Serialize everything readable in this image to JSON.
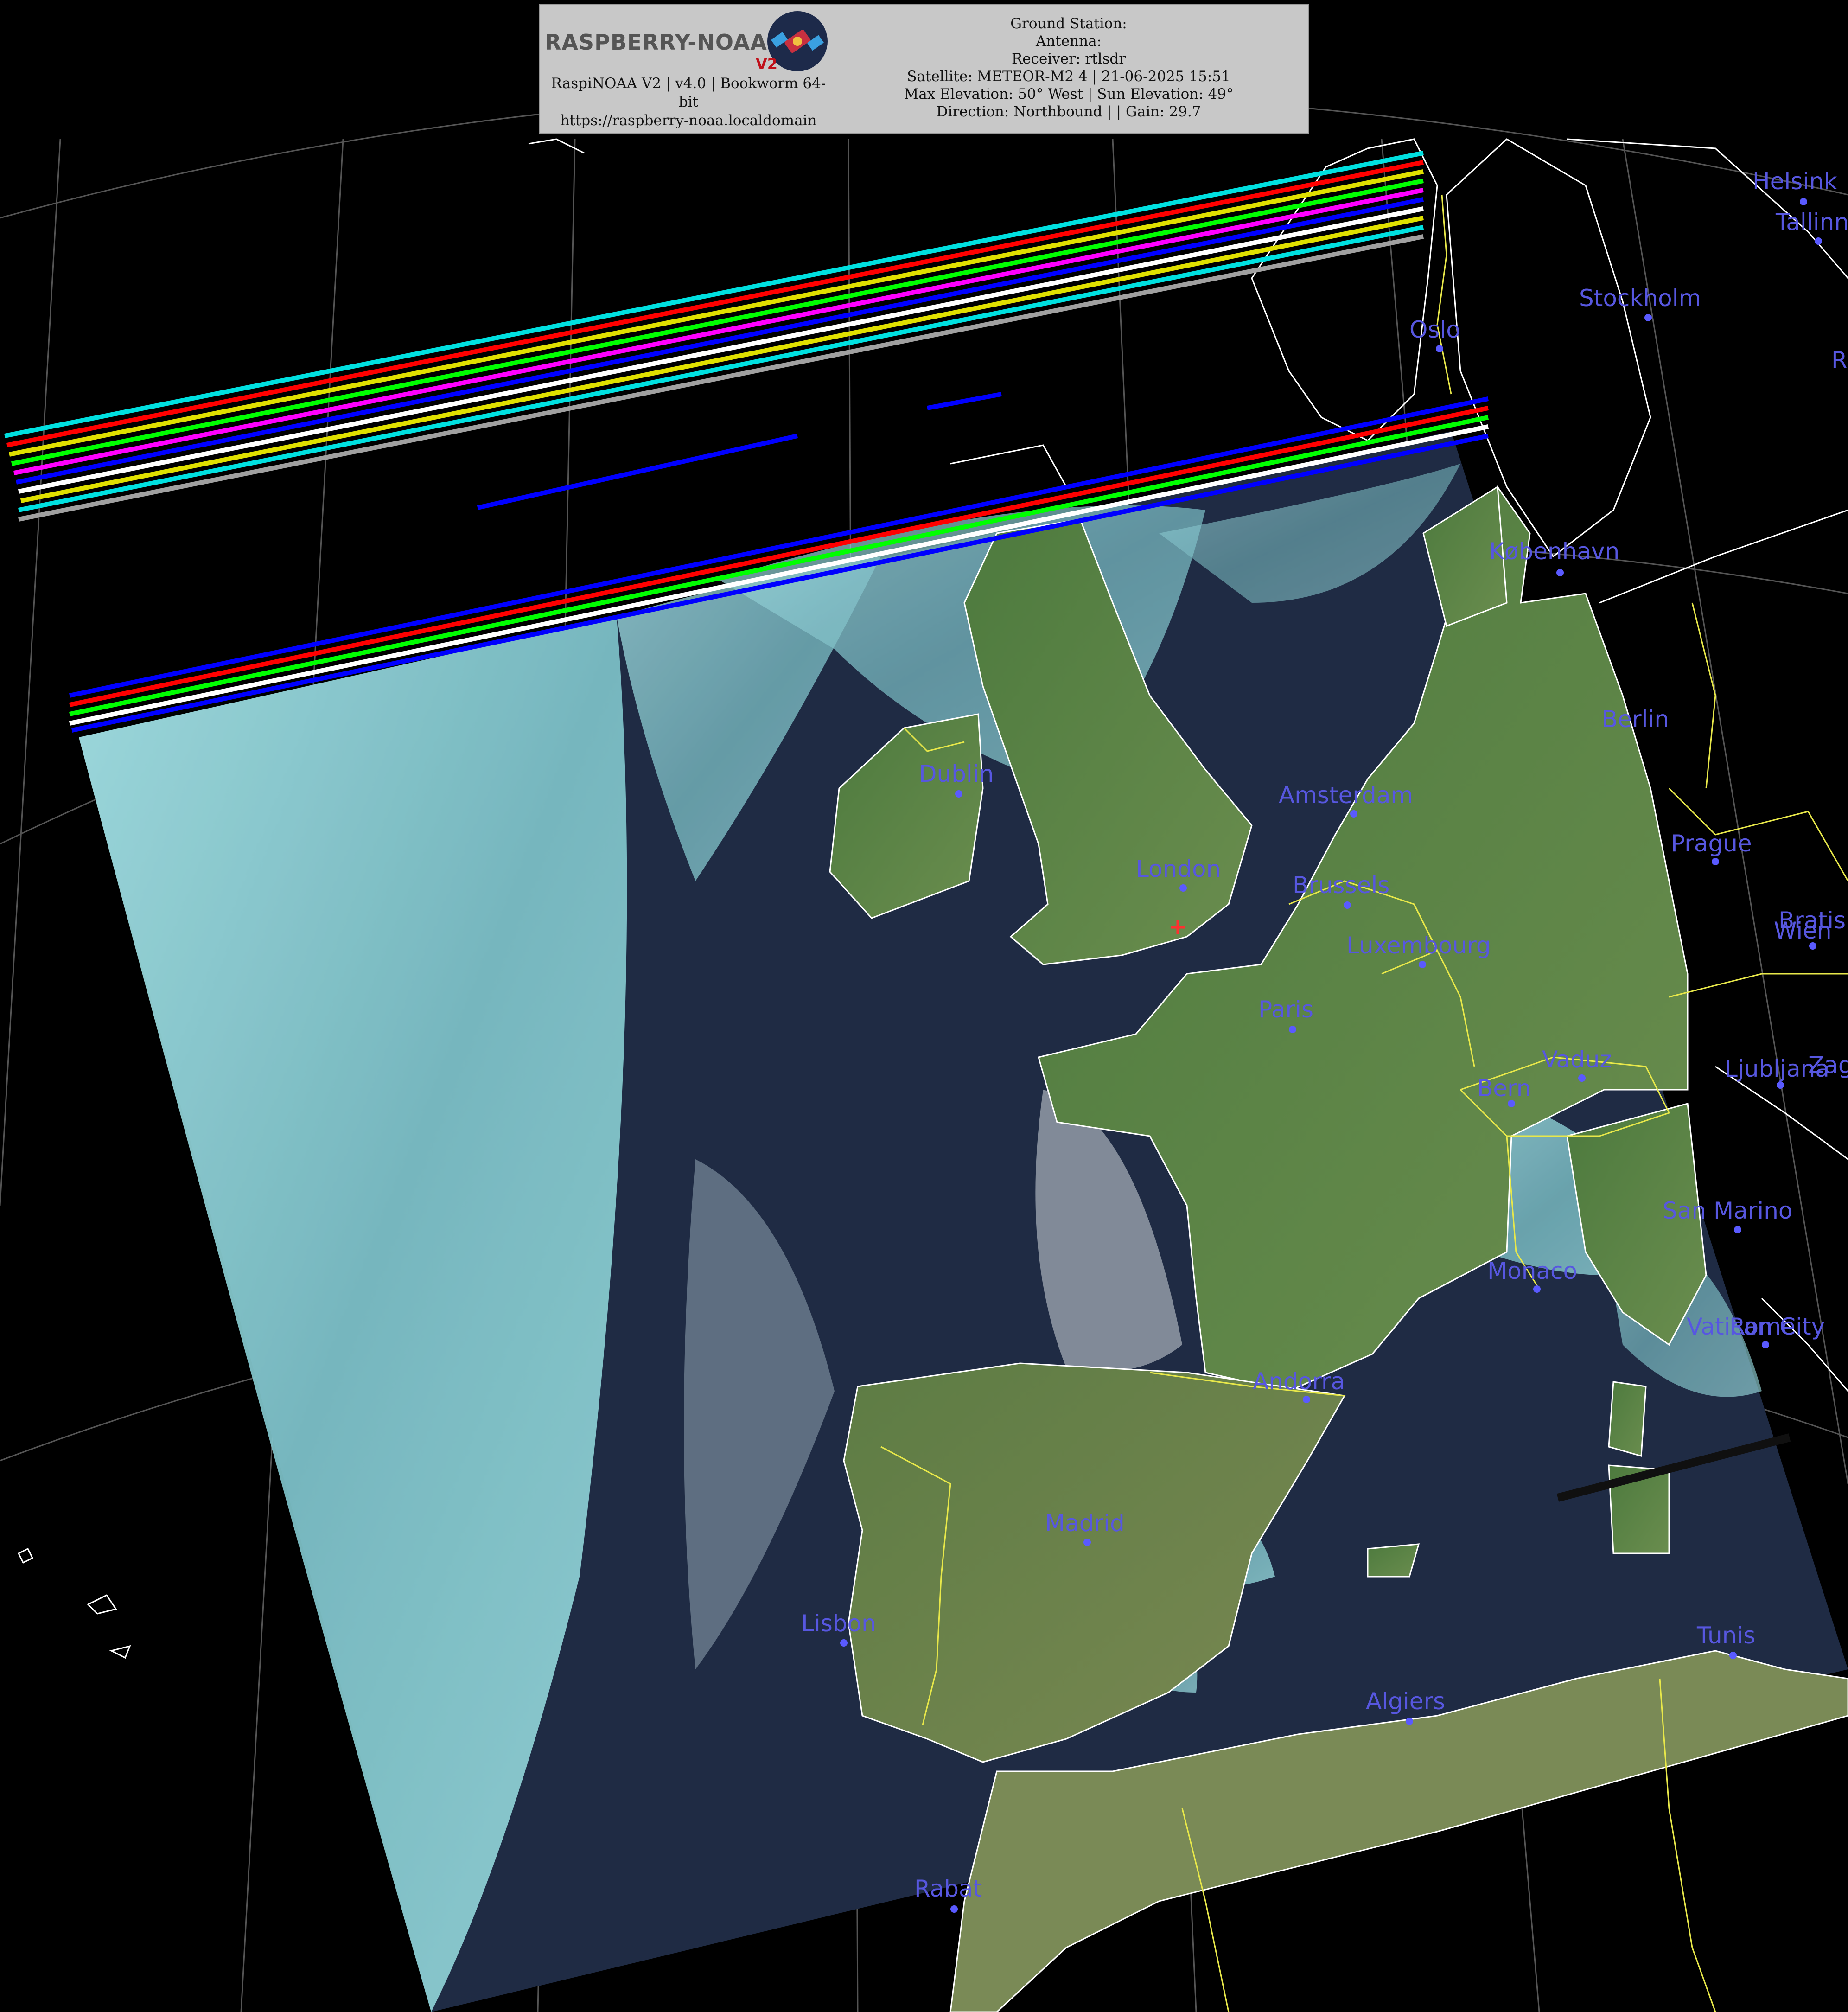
{
  "header": {
    "logo_text": "RASPBERRY-NOAA",
    "logo_version": "V2",
    "app_line1": "RaspiNOAA V2 | v4.0 | Bookworm 64-",
    "app_line2": "bit",
    "app_url": "https://raspberry-noaa.localdomain",
    "ground_station": "Ground Station:",
    "antenna": "Antenna:",
    "receiver": "Receiver: rtlsdr",
    "satellite": "Satellite: METEOR-M2 4 | 21-06-2025 15:51",
    "elevation": "Max Elevation: 50° West | Sun Elevation: 49°",
    "direction": "Direction: Northbound | | Gain: 29.7"
  },
  "cities": {
    "helsinki": "Helsink",
    "tallinn": "Tallinn",
    "stockholm": "Stockholm",
    "oslo": "Oslo",
    "kobenhavn": "København",
    "berlin": "Berlin",
    "dublin": "Dublin",
    "amsterdam": "Amsterdam",
    "london": "London",
    "brussels": "Brussels",
    "luxembourg": "Luxembourg",
    "prague": "Prague",
    "wien": "Wien",
    "bratislava": "Bratis",
    "paris": "Paris",
    "vaduz": "Vaduz",
    "bern": "Bern",
    "ljubljana": "Ljubljana",
    "zagreb": "Zag",
    "san_marino": "San Marino",
    "monaco": "Monaco",
    "vatican": "Vatican City",
    "rome": "Rome",
    "andorra": "Andorra",
    "madrid": "Madrid",
    "lisbon": "Lisbon",
    "tunis": "Tunis",
    "algiers": "Algiers",
    "rabat": "Rabat",
    "partial_right": "R"
  },
  "colors": {
    "city_label": "#5757e0",
    "ocean": "#1f2b44",
    "land": "#5e8a48",
    "cloud": "#8fd8dc",
    "coastline": "#ffffff",
    "border": "#e8e84a",
    "header_bg": "#c8c8c8"
  }
}
